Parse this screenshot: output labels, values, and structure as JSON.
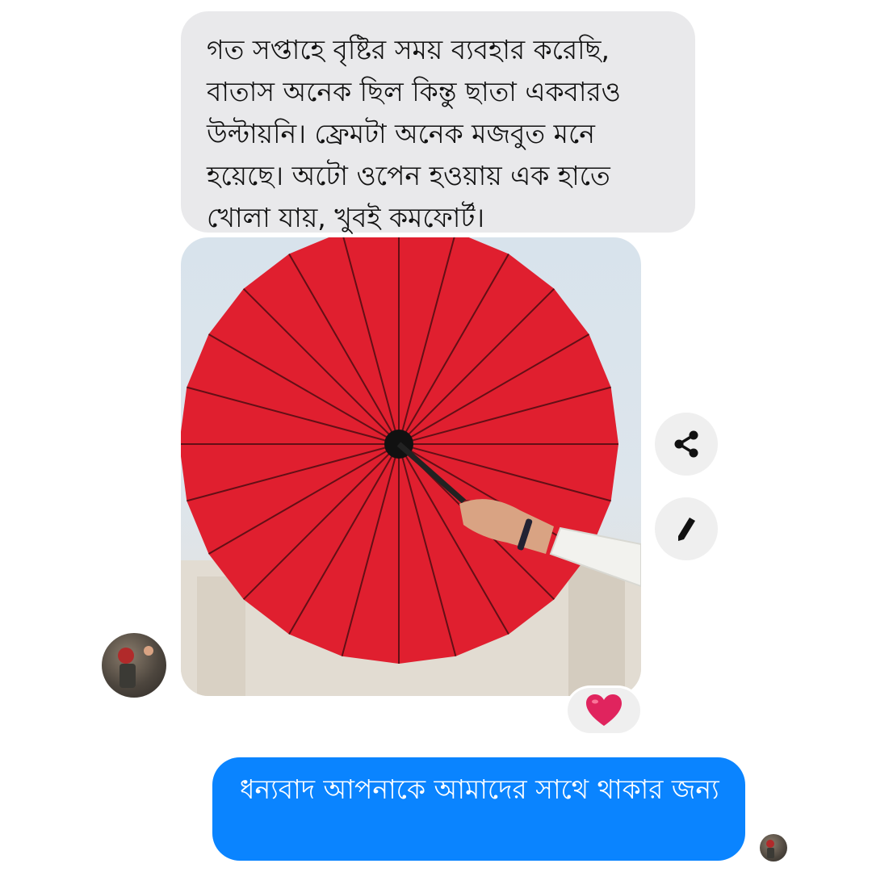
{
  "messages": {
    "incoming_text": "গত সপ্তাহে বৃষ্টির সময় ব্যবহার করেছি, বাতাস অনেক ছিল কিন্তু ছাতা একবারও উল্টায়নি। ফ্রেমটা অনেক মজবুত মনে হয়েছে। অটো ওপেন হওয়ায় এক হাতে খোলা যায়, খুবই কমফোর্ট।",
    "outgoing_text": "ধন্যবাদ আপনাকে আমাদের সাথে থাকার জন্য"
  },
  "reaction": {
    "emoji": "❤️"
  },
  "actions": {
    "share_icon": "share-icon",
    "edit_icon": "pencil-icon"
  },
  "colors": {
    "incoming_bubble": "#e9e9eb",
    "outgoing_bubble": "#0a84ff",
    "reaction_heart": "#e0245e",
    "umbrella": "#e01f2f"
  }
}
